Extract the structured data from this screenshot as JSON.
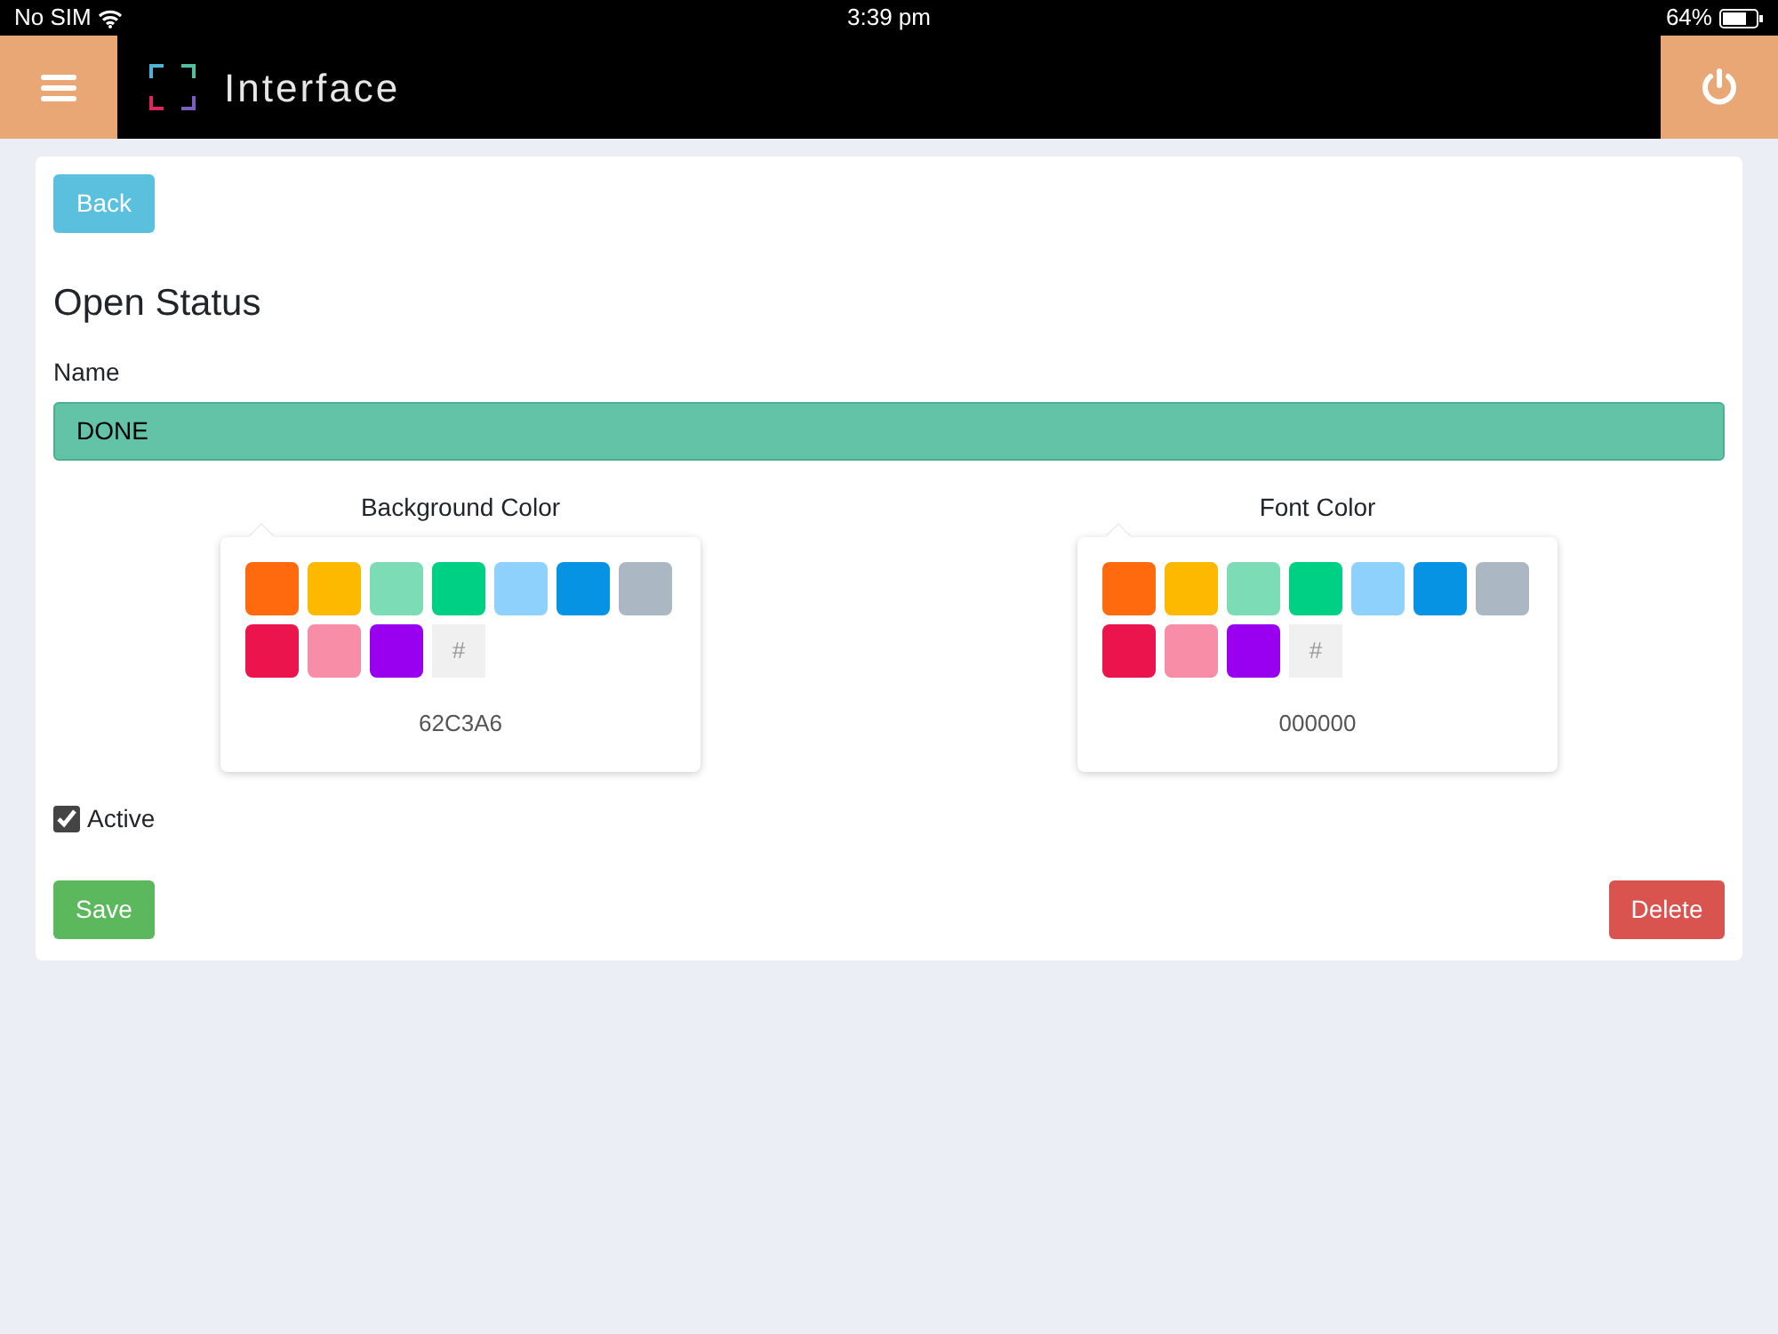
{
  "status_bar": {
    "carrier": "No SIM",
    "time": "3:39 pm",
    "battery": "64%"
  },
  "app_bar": {
    "title": "Interface"
  },
  "form": {
    "back_button": "Back",
    "heading": "Open Status",
    "name_label": "Name",
    "name_value": "DONE",
    "pickers": [
      {
        "label": "Background Color",
        "custom_button": "#",
        "value": "62C3A6",
        "swatches": [
          {
            "color": "#ff6a0e"
          },
          {
            "color": "#fcb900"
          },
          {
            "color": "#7bdcb5"
          },
          {
            "color": "#00d084"
          },
          {
            "color": "#8ed1fc"
          },
          {
            "color": "#0693e3"
          },
          {
            "color": "#abb8c3"
          },
          {
            "color": "#eb144c"
          },
          {
            "color": "#f78da7"
          },
          {
            "color": "#9900ef"
          }
        ]
      },
      {
        "label": "Font Color",
        "custom_button": "#",
        "value": "000000",
        "swatches": [
          {
            "color": "#ff6a0e"
          },
          {
            "color": "#fcb900"
          },
          {
            "color": "#7bdcb5"
          },
          {
            "color": "#00d084"
          },
          {
            "color": "#8ed1fc"
          },
          {
            "color": "#0693e3"
          },
          {
            "color": "#abb8c3"
          },
          {
            "color": "#eb144c"
          },
          {
            "color": "#f78da7"
          },
          {
            "color": "#9900ef"
          }
        ]
      }
    ],
    "active": {
      "label": "Active",
      "checked": true
    },
    "save_button": "Save",
    "delete_button": "Delete"
  }
}
